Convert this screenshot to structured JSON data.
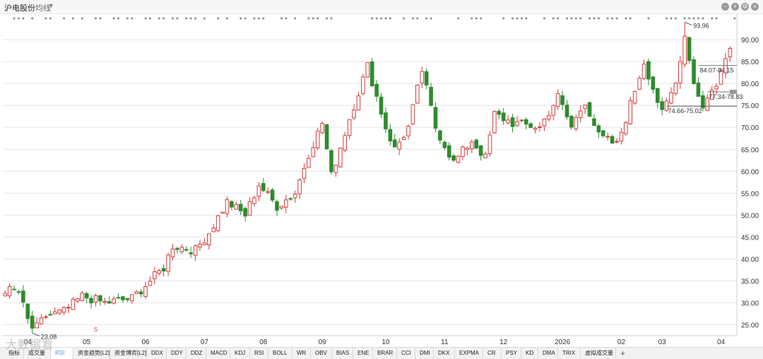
{
  "header": {
    "title": "沪电股份",
    "ma_label": "均线",
    "controls": [
      "−",
      "+",
      "⚙",
      "×"
    ]
  },
  "chart_data": {
    "type": "candlestick",
    "ylim": [
      22.5,
      95.5
    ],
    "y_ticks": [
      25,
      30,
      35,
      40,
      45,
      50,
      55,
      60,
      65,
      70,
      75,
      80,
      85,
      90
    ],
    "y_tick_labels": [
      "25.00",
      "30.00",
      "35.00",
      "40.00",
      "45.00",
      "50.00",
      "55.00",
      "60.00",
      "65.00",
      "70.00",
      "75.00",
      "80.00",
      "85.00",
      "90.00"
    ],
    "x_ticks": [
      {
        "label": "04",
        "index": 5
      },
      {
        "label": "05",
        "index": 18
      },
      {
        "label": "06",
        "index": 31
      },
      {
        "label": "07",
        "index": 44
      },
      {
        "label": "08",
        "index": 57
      },
      {
        "label": "09",
        "index": 70
      },
      {
        "label": "10",
        "index": 84
      },
      {
        "label": "11",
        "index": 97
      },
      {
        "label": "12",
        "index": 110
      },
      {
        "label": "2026",
        "index": 123
      },
      {
        "label": "02",
        "index": 136
      },
      {
        "label": "03",
        "index": 145
      },
      {
        "label": "04",
        "index": 158
      }
    ],
    "anchors": [
      [
        0,
        33
      ],
      [
        3,
        32.5
      ],
      [
        5,
        26
      ],
      [
        6,
        23.08
      ],
      [
        9,
        27
      ],
      [
        13,
        28
      ],
      [
        17,
        31.5
      ],
      [
        22,
        30
      ],
      [
        28,
        31
      ],
      [
        32,
        35
      ],
      [
        35,
        38
      ],
      [
        37,
        43
      ],
      [
        42,
        42
      ],
      [
        45,
        46
      ],
      [
        49,
        53
      ],
      [
        53,
        50
      ],
      [
        56,
        57
      ],
      [
        60,
        52
      ],
      [
        64,
        55
      ],
      [
        67,
        64
      ],
      [
        70,
        71
      ],
      [
        72,
        59
      ],
      [
        76,
        72
      ],
      [
        80,
        84
      ],
      [
        84,
        70
      ],
      [
        86,
        65
      ],
      [
        89,
        70
      ],
      [
        92,
        83
      ],
      [
        95,
        70
      ],
      [
        99,
        62
      ],
      [
        103,
        67
      ],
      [
        106,
        63
      ],
      [
        108,
        73
      ],
      [
        112,
        71
      ],
      [
        118,
        70
      ],
      [
        122,
        77
      ],
      [
        125,
        70
      ],
      [
        128,
        76
      ],
      [
        131,
        68
      ],
      [
        135,
        66
      ],
      [
        137,
        72
      ],
      [
        141,
        85
      ],
      [
        145,
        73
      ],
      [
        148,
        80
      ],
      [
        150,
        92
      ],
      [
        152,
        80
      ],
      [
        154,
        75
      ],
      [
        157,
        80
      ],
      [
        160,
        88
      ]
    ],
    "markers": [
      {
        "label": "93.96",
        "index": 150,
        "value": 93.96
      },
      {
        "label": "23.08",
        "index": 6,
        "value": 23.08
      }
    ],
    "hlines": [
      {
        "label": "84.07-84.15",
        "value": 84.1,
        "from": 153
      },
      {
        "label": "77.34-78.83",
        "value": 78.1,
        "from": 155,
        "boxed": true
      },
      {
        "label": "74.66-75.02",
        "value": 74.84,
        "from": 146
      }
    ],
    "signal_s": {
      "label": "S",
      "index": 20
    },
    "colors": {
      "up": "#d63b3b",
      "down": "#2e8b2e",
      "grid": "#e6e6e6",
      "axis_text": "#333333",
      "dots": "#8c8c8c"
    }
  },
  "bottom_tabs": [
    "指标",
    "成交量",
    "RSI",
    "资金趋势[L2]",
    "资金博弈[L2]",
    "DDX",
    "DDY",
    "DDZ",
    "MACD",
    "KDJ",
    "RSI",
    "BOLL",
    "WR",
    "OBV",
    "BIAS",
    "ENE",
    "BRAR",
    "CCI",
    "DMI",
    "DKX",
    "EXPMA",
    "CR",
    "PSY",
    "KD",
    "DMA",
    "TRIX",
    "虚拟成交量",
    "+"
  ],
  "watermark": "大数据看"
}
